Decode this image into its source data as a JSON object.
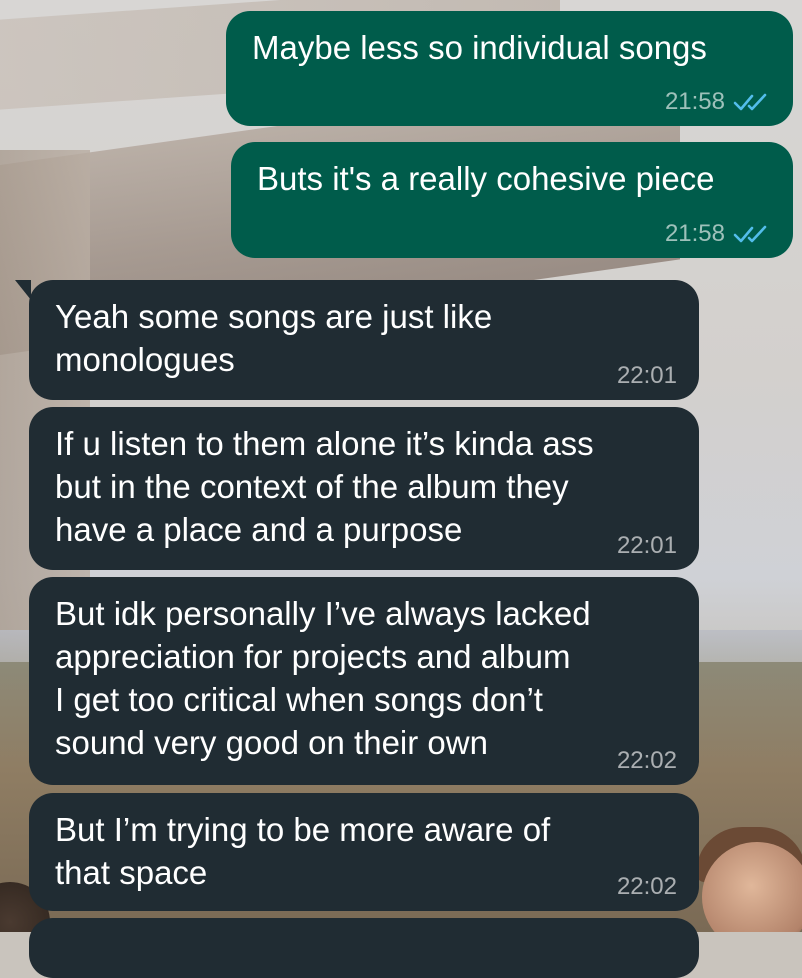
{
  "messages": [
    {
      "direction": "outgoing",
      "text": "Maybe less so individual songs",
      "time": "21:58",
      "status": "read"
    },
    {
      "direction": "outgoing",
      "text": "Buts it's a really cohesive piece",
      "time": "21:58",
      "status": "read"
    },
    {
      "direction": "incoming",
      "text": "Yeah some songs are just like\nmonologues",
      "time": "22:01"
    },
    {
      "direction": "incoming",
      "text": "If u listen to them alone it’s kinda ass\nbut in the context of the album they\nhave a place and a purpose",
      "time": "22:01"
    },
    {
      "direction": "incoming",
      "text": "But idk personally I’ve always lacked\nappreciation for projects and album\nI get too critical when songs don’t\nsound very good on their own",
      "time": "22:02"
    },
    {
      "direction": "incoming",
      "text": "But I’m trying to be more aware of\nthat space",
      "time": "22:02"
    }
  ],
  "colors": {
    "outgoing_bubble": "#005c4b",
    "incoming_bubble": "#202c33",
    "read_ticks": "#53bdeb"
  },
  "icons": {
    "read_receipt": "double-check-icon"
  }
}
